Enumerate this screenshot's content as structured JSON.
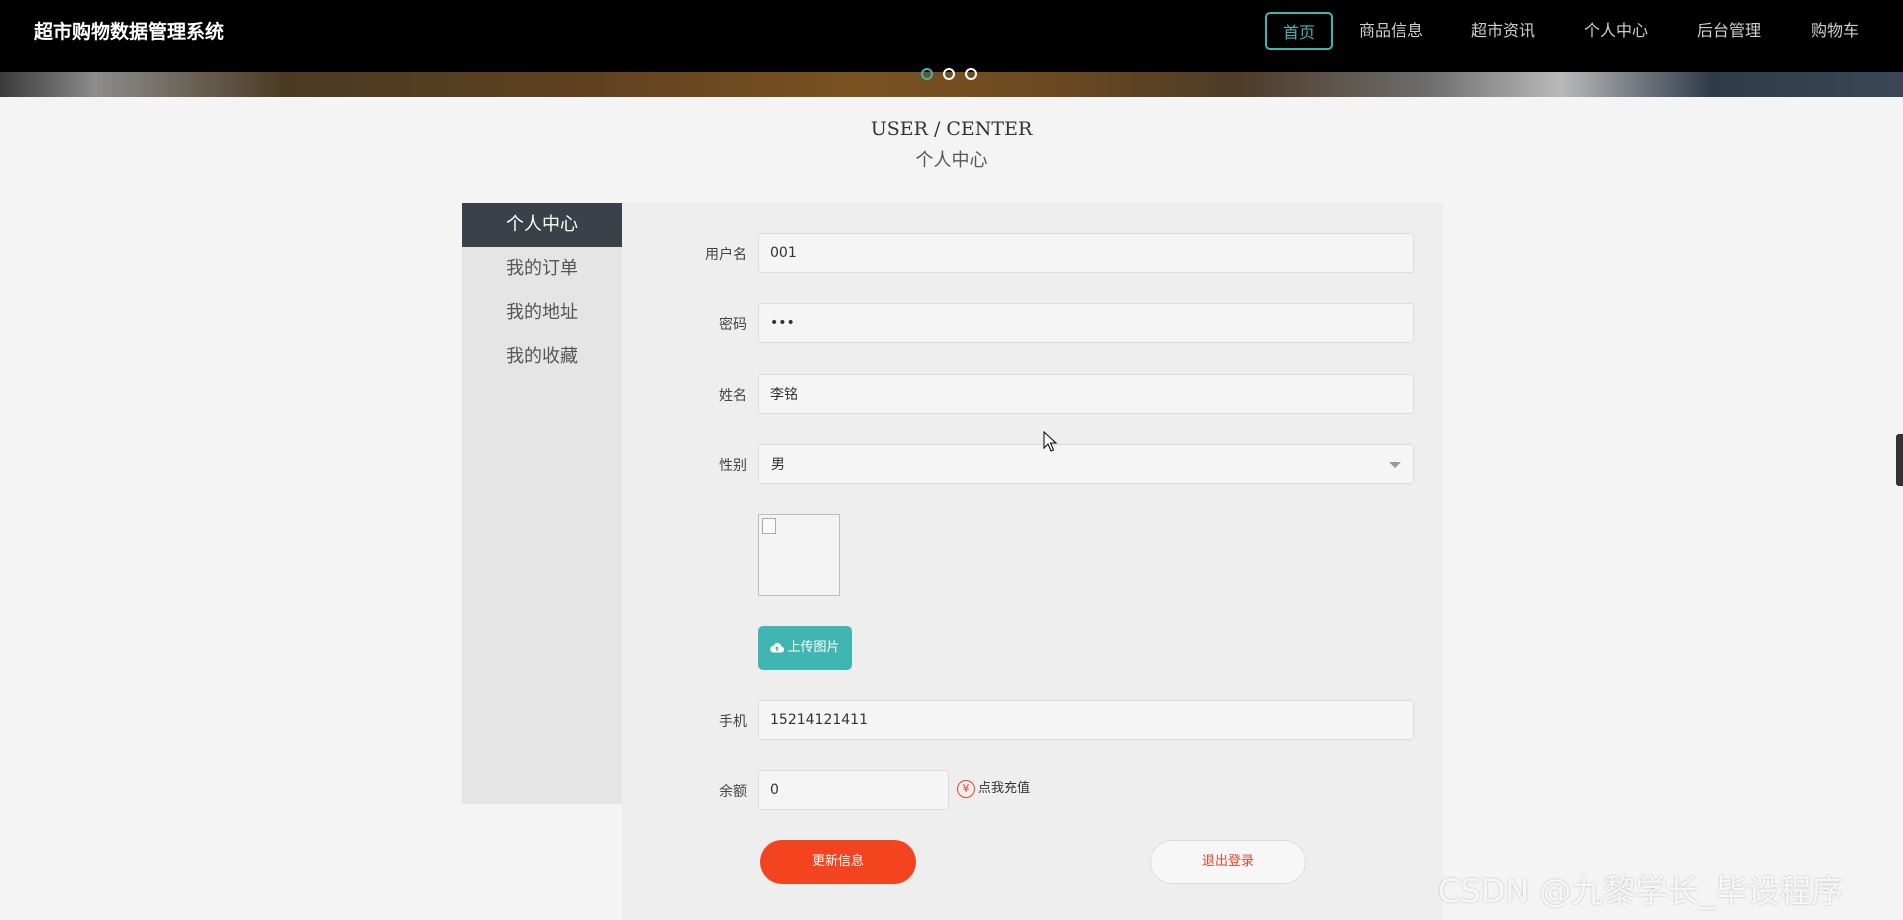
{
  "app": {
    "title": "超市购物数据管理系统"
  },
  "nav": {
    "items": [
      {
        "label": "首页",
        "active": true
      },
      {
        "label": "商品信息"
      },
      {
        "label": "超市资讯"
      },
      {
        "label": "个人中心"
      },
      {
        "label": "后台管理"
      },
      {
        "label": "购物车"
      }
    ]
  },
  "carousel": {
    "slide_count": 3,
    "active_index": 0
  },
  "page": {
    "title_en": "USER / CENTER",
    "title_cn": "个人中心"
  },
  "sidebar": {
    "items": [
      {
        "label": "个人中心",
        "active": true
      },
      {
        "label": "我的订单"
      },
      {
        "label": "我的地址"
      },
      {
        "label": "我的收藏"
      }
    ]
  },
  "form": {
    "username": {
      "label": "用户名",
      "value": "001"
    },
    "password": {
      "label": "密码",
      "value": "123"
    },
    "name": {
      "label": "姓名",
      "value": "李铭"
    },
    "gender": {
      "label": "性别",
      "value": "男"
    },
    "upload_label": "上传图片",
    "phone": {
      "label": "手机",
      "value": "15214121411"
    },
    "balance": {
      "label": "余额",
      "value": "0",
      "recharge_label": "点我充值"
    },
    "update_label": "更新信息",
    "logout_label": "退出登录"
  },
  "icons": {
    "upload": "cloud-upload-icon",
    "recharge": "yen-icon",
    "dropdown": "chevron-down-icon",
    "image_placeholder": "broken-image-icon"
  },
  "colors": {
    "accent": "#3fb6b2",
    "primary_button": "#f4431f",
    "danger_text": "#e8452c",
    "header_bg": "#000000",
    "sidebar_active": "#3a4149"
  },
  "watermark": "CSDN @九黎学长_毕设程序"
}
